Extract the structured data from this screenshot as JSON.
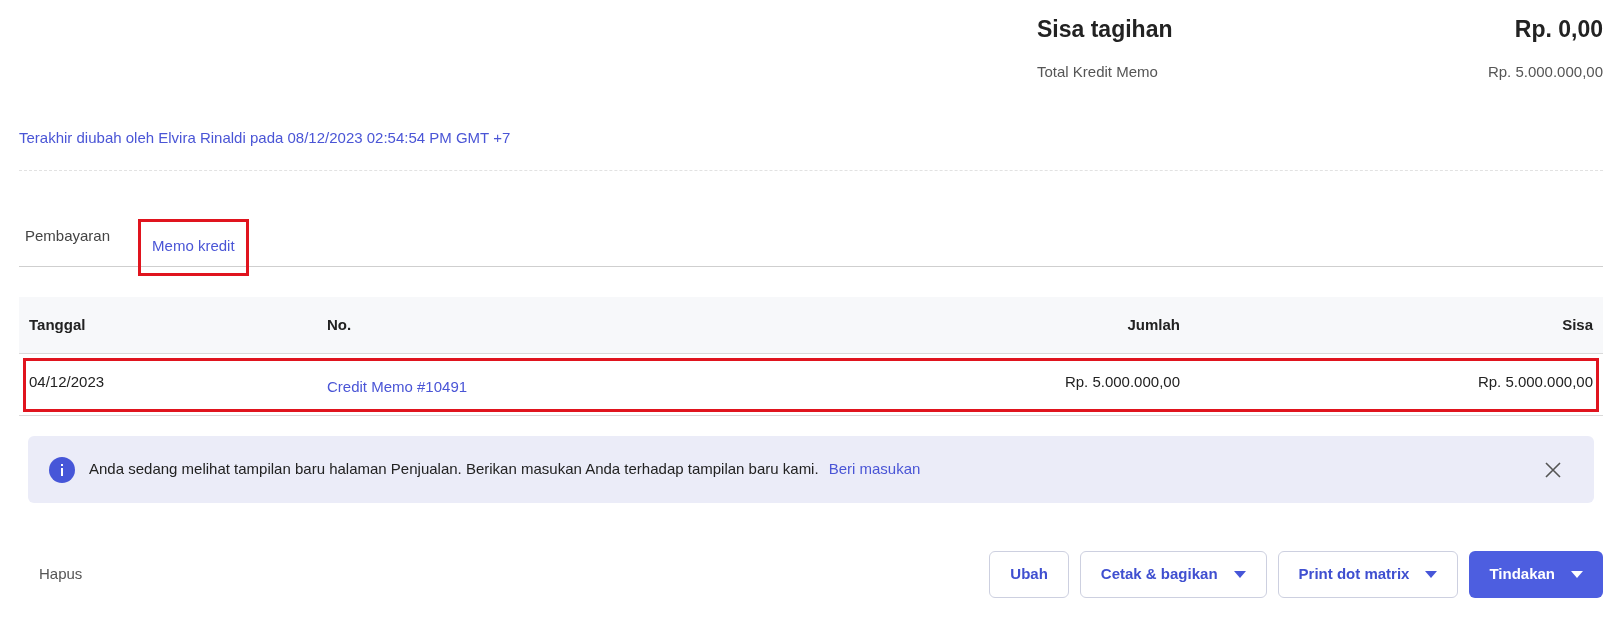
{
  "summary": [
    {
      "kind": "total",
      "label": "Sisa tagihan",
      "value": "Rp. 0,00"
    },
    {
      "kind": "sub",
      "label": "Total Kredit Memo",
      "value": "Rp. 5.000.000,00"
    }
  ],
  "last_modified": "Terakhir diubah oleh Elvira Rinaldi pada 08/12/2023 02:54:54 PM GMT +7",
  "tabs": [
    {
      "label": "Pembayaran",
      "selected": false,
      "highlighted": false
    },
    {
      "label": "Memo kredit",
      "selected": true,
      "highlighted": true
    }
  ],
  "table": {
    "columns": [
      "Tanggal",
      "No.",
      "Jumlah",
      "Sisa"
    ],
    "rows": [
      {
        "cells": [
          "04/12/2023",
          "Credit Memo #10491",
          "Rp. 5.000.000,00",
          "Rp. 5.000.000,00"
        ],
        "highlighted": true
      }
    ]
  },
  "banner": {
    "text": "Anda sedang melihat tampilan baru halaman Penjualan. Berikan masukan Anda terhadap tampilan baru kami.",
    "link": "Beri masukan"
  },
  "footer": {
    "delete": "Hapus",
    "buttons": [
      {
        "label": "Ubah",
        "kind": "plain"
      },
      {
        "label": "Cetak & bagikan",
        "kind": "dropdown"
      },
      {
        "label": "Print dot matrix",
        "kind": "dropdown"
      },
      {
        "label": "Tindakan",
        "kind": "primary"
      }
    ]
  }
}
